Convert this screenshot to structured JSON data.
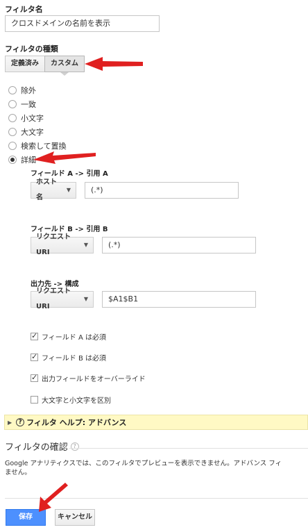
{
  "filter_name": {
    "label": "フィルタ名",
    "value": "クロスドメインの名前を表示"
  },
  "filter_type": {
    "label": "フィルタの種類",
    "tabs": [
      "定義済み",
      "カスタム"
    ],
    "active_tab": "カスタム"
  },
  "options": [
    {
      "label": "除外",
      "checked": false
    },
    {
      "label": "一致",
      "checked": false
    },
    {
      "label": "小文字",
      "checked": false
    },
    {
      "label": "大文字",
      "checked": false
    },
    {
      "label": "検索して置換",
      "checked": false
    },
    {
      "label": "詳細",
      "checked": true
    }
  ],
  "field_a": {
    "label": "フィールド A -> 引用 A",
    "select": "ホスト名",
    "value": "(.*)"
  },
  "field_b": {
    "label": "フィールド B -> 引用 B",
    "select": "リクエスト URI",
    "value": "(.*)"
  },
  "output": {
    "label": "出力先 -> 構成",
    "select": "リクエスト URI",
    "value": "$A1$B1"
  },
  "checks": [
    {
      "label": "フィールド A は必須",
      "checked": true
    },
    {
      "label": "フィールド B は必須",
      "checked": true
    },
    {
      "label": "出力フィールドをオーバーライド",
      "checked": true
    },
    {
      "label": "大文字と小文字を区別",
      "checked": false
    }
  ],
  "help": {
    "label": "フィルタ ヘルプ: アドバンス"
  },
  "verify": {
    "title": "フィルタの確認",
    "help_symbol": "?",
    "message_line1": "Google アナリティクスでは、このフィルタでプレビューを表示できません。アドバンス フィ",
    "message_line2": "ません。"
  },
  "buttons": {
    "save": "保存",
    "cancel": "キャンセル"
  },
  "colors": {
    "accent_blue": "#4d90fe",
    "arrow_red": "#e02020",
    "help_bg": "#fff9c4"
  }
}
